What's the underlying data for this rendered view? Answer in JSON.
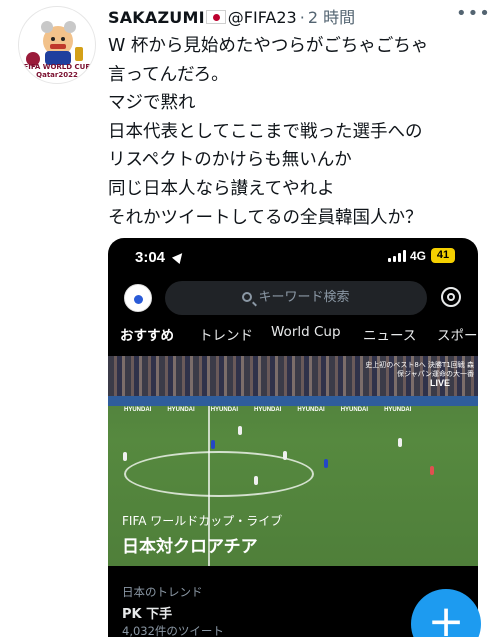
{
  "author": {
    "display_name": "SAKAZUMI",
    "handle": "@FIFA23",
    "time": "2 時間",
    "avatar_banner": "FIFA WORLD CUP Qatar2022"
  },
  "tweet": {
    "lines": [
      "W 杯から見始めたやつらがごちゃごちゃ",
      "言ってんだろ。",
      "マジで黙れ",
      "日本代表としてここまで戦った選手への",
      "リスペクトのかけらも無いんか",
      "同じ日本人なら讃えてやれよ",
      "それかツイートしてるの全員韓国人か？"
    ]
  },
  "screenshot": {
    "status": {
      "time": "3:04",
      "network": "4G",
      "battery": "41"
    },
    "search_placeholder": "キーワード検索",
    "tabs": [
      "おすすめ",
      "トレンド",
      "World Cup",
      "ニュース",
      "スポーツ"
    ],
    "hero": {
      "overlay": "史上初のベスト8へ 決勝T1回戦 森保ジャパン運命の大一番",
      "live": "LIVE",
      "board": "HYUNDAI",
      "subtitle": "FIFA ワールドカップ・ライブ",
      "title": "日本対クロアチア"
    },
    "trend": {
      "header": "日本のトレンド",
      "title": "PK 下手",
      "count": "4,032件のツイート"
    }
  },
  "icons": [
    "more-icon",
    "flag-icon",
    "location-arrow-icon",
    "signal-icon",
    "search-icon",
    "settings-gear-icon",
    "compose-plus-icon"
  ],
  "colors": {
    "accent": "#1d9bf0",
    "text": "#0f1419",
    "muted": "#536471",
    "battery": "#f5d000",
    "pitch": "#56893f"
  }
}
